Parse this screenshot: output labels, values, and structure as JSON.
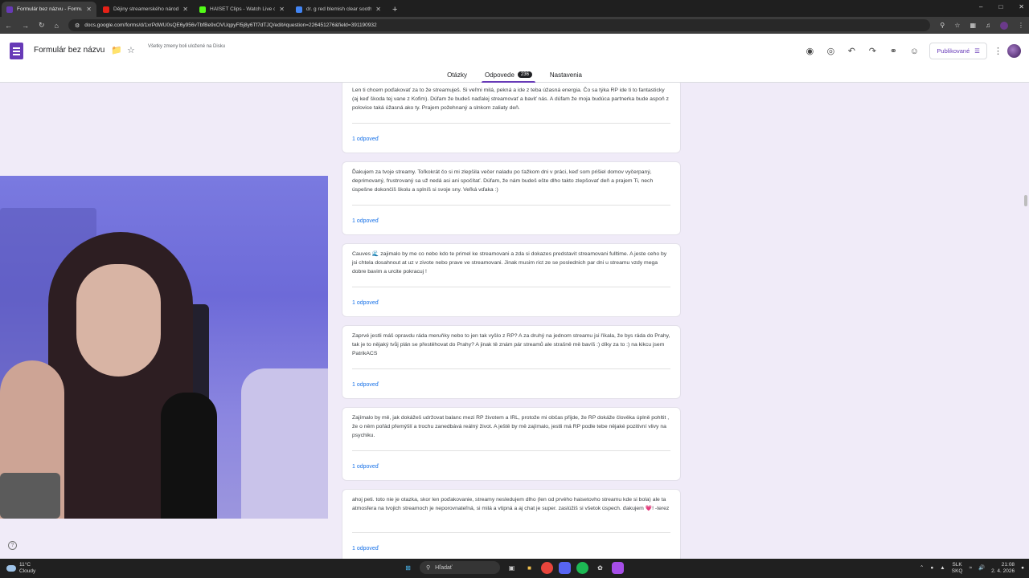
{
  "browser": {
    "tabs": [
      {
        "title": "Formulár bez názvu - Formulár",
        "active": true,
        "color": "#673ab7"
      },
      {
        "title": "Dějiny streamerského národa",
        "active": false,
        "color": "#e62117"
      },
      {
        "title": "HAISET Clips - Watch Live o",
        "active": false,
        "color": "#53fc18"
      },
      {
        "title": "dr. g red blemish clear soothin",
        "active": false,
        "color": "#4285f4"
      }
    ],
    "url": "docs.google.com/forms/d/1xrPdWU0sQE6y956vTbfBe9xOVUqpyFl5j8y6Tf7dTJQ/edit#question=226451276&field=391190932"
  },
  "header": {
    "form_title": "Formulár bez názvu",
    "saved_note": "Všetky zmeny boli uložené na Disku",
    "publish_label": "Publikované"
  },
  "form_tabs": {
    "questions": "Otázky",
    "responses": "Odpovede",
    "responses_count": "236",
    "settings": "Nastavenia"
  },
  "responses": [
    {
      "text": "Len ti chcem poďakovať za to že streamuješ. Si veľmi milá, pekná a ide z teba úžasná energia. Čo sa týka RP ide ti to fantasticky (aj keď škoda tej vane z Kofim). Dúfam že budeš naďalej streamovať a baviť nás. A dúfam že moja budúca partnerka bude aspoň z polovice taká úžasná ako ty. Prajem požehnaný a slnkom zaliaty deň.",
      "count_label": "1 odpoveď"
    },
    {
      "text": "Ďakujem za tvoje streamy. Toľkokrát čo si mi zlepšila večer naladu po ťažkom dni v práci, keď som prišiel domov vyčerpaný, deprimovaný, frustrovaný sa už nedá asi ani spočítať. Dúfam, že nám budeš ešte dlho takto zlepšovať deň a prajem Ti, nech úspešne dokončíš školu a splníš si svoje sny. Veľká vďaka :)",
      "count_label": "1 odpoveď"
    },
    {
      "text": "Cauves 🌊 zajimalo by me co nebo kdo te primel ke streamovani a zda si dokazes predstavit streamovani fulltime. A jeste ceho by jsi chtela dosahnout at uz v zivote nebo prave ve streamovani. Jinak musim rict ze se poslednich par dni u streamu vzdy mega dobre bavim a urcite pokracuj !",
      "count_label": "1 odpoveď"
    },
    {
      "text": "Zaprvé jestli máš opravdu ráda meruňky nebo to jen tak vyšlo z RP? A za druhý na jednom streamu jsi říkala, že bys ráda do Prahy, tak je to nějaký tvůj plán se přestěhovat do Prahy? A jinak tě znám pár streamů ale strašně mě bavíš :) díky za to :) na kikcu jsem PatrikACS",
      "count_label": "1 odpoveď"
    },
    {
      "text": "Zajímalo by mě, jak dokážeš udržovat balanc mezi RP životem a IRL, protože mi občas přijde, že RP dokáže člověka úplně pohltit , že o něm pořád přemýšlí a trochu zanedbává reálný život. A ještě by mě zajímalo, jestli má RP podle tebe nějaké pozitivní vlivy na psychiku.",
      "count_label": "1 odpoveď"
    },
    {
      "text": "ahoj peti. toto nie je otazka, skor len poďakovanie, streamy nesledujem dlho (len od prvého haisetovho streamu kde si bola) ale ta atmosfera na tvojich streamoch je neporovnateľná, si milá a vtipná a aj chat je super. zaslúžiš si všetok úspech. ďakujem 💗! -terez",
      "count_label": "1 odpoveď"
    }
  ],
  "taskbar": {
    "temp": "11°C",
    "weather": "Cloudy",
    "search_placeholder": "Hľadať",
    "lang": "SLK",
    "lang2": "SKQ",
    "time": "21:08",
    "date": "2. 4. 2026"
  }
}
